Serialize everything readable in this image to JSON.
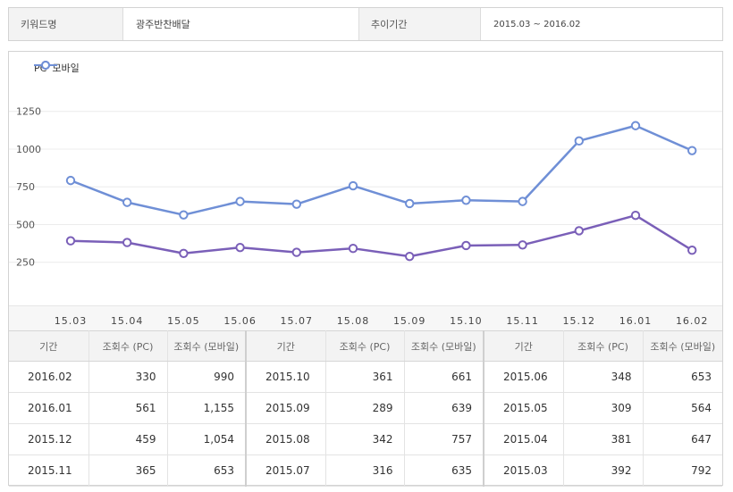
{
  "header": {
    "keyword_label": "키워드명",
    "keyword_value": "광주반찬배달",
    "period_label": "추이기간",
    "period_value": "2015.03 ~ 2016.02"
  },
  "colors": {
    "pc": "#7a5fb8",
    "mobile": "#6f8fd6"
  },
  "chart_data": {
    "type": "line",
    "categories": [
      "15.03",
      "15.04",
      "15.05",
      "15.06",
      "15.07",
      "15.08",
      "15.09",
      "15.10",
      "15.11",
      "15.12",
      "16.01",
      "16.02"
    ],
    "series": [
      {
        "name": "PC",
        "values": [
          392,
          381,
          309,
          348,
          316,
          342,
          289,
          361,
          365,
          459,
          561,
          330
        ]
      },
      {
        "name": "모바일",
        "values": [
          792,
          647,
          564,
          653,
          635,
          757,
          639,
          661,
          653,
          1054,
          1155,
          990
        ]
      }
    ],
    "y_ticks": [
      "250",
      "500",
      "750",
      "1000",
      "1250"
    ],
    "ylim": [
      0,
      1250
    ],
    "legend_position": "top-left",
    "grid": true
  },
  "table": {
    "headers": [
      "기간",
      "조회수 (PC)",
      "조회수 (모바일)"
    ],
    "rows": [
      [
        [
          "2016.02",
          "330",
          "990"
        ],
        [
          "2015.10",
          "361",
          "661"
        ],
        [
          "2015.06",
          "348",
          "653"
        ]
      ],
      [
        [
          "2016.01",
          "561",
          "1,155"
        ],
        [
          "2015.09",
          "289",
          "639"
        ],
        [
          "2015.05",
          "309",
          "564"
        ]
      ],
      [
        [
          "2015.12",
          "459",
          "1,054"
        ],
        [
          "2015.08",
          "342",
          "757"
        ],
        [
          "2015.04",
          "381",
          "647"
        ]
      ],
      [
        [
          "2015.11",
          "365",
          "653"
        ],
        [
          "2015.07",
          "316",
          "635"
        ],
        [
          "2015.03",
          "392",
          "792"
        ]
      ]
    ]
  }
}
